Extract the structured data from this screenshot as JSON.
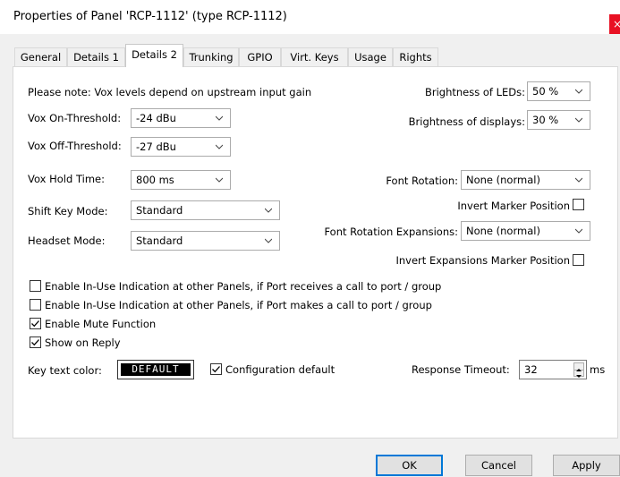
{
  "window": {
    "title": "Properties of Panel 'RCP-1112' (type RCP-1112)",
    "close_glyph": "×"
  },
  "tabs": [
    {
      "label": "General",
      "active": false
    },
    {
      "label": "Details 1",
      "active": false
    },
    {
      "label": "Details 2",
      "active": true
    },
    {
      "label": "Trunking",
      "active": false
    },
    {
      "label": "GPIO",
      "active": false
    },
    {
      "label": "Virt. Keys",
      "active": false
    },
    {
      "label": "Usage",
      "active": false
    },
    {
      "label": "Rights",
      "active": false
    }
  ],
  "details2": {
    "note": "Please note: Vox levels depend on upstream input gain",
    "vox_on": {
      "label": "Vox On-Threshold:",
      "value": "-24 dBu"
    },
    "vox_off": {
      "label": "Vox Off-Threshold:",
      "value": "-27 dBu"
    },
    "vox_hold": {
      "label": "Vox Hold Time:",
      "value": "800 ms"
    },
    "shift_key": {
      "label": "Shift Key Mode:",
      "value": "Standard"
    },
    "headset": {
      "label": "Headset Mode:",
      "value": "Standard"
    },
    "brightness_leds": {
      "label": "Brightness of LEDs:",
      "value": "50 %"
    },
    "brightness_displays": {
      "label": "Brightness of displays:",
      "value": "30 %"
    },
    "font_rotation": {
      "label": "Font Rotation:",
      "value": "None (normal)"
    },
    "invert_marker": {
      "label": "Invert Marker Position",
      "checked": false
    },
    "font_rotation_exp": {
      "label": "Font Rotation Expansions:",
      "value": "None (normal)"
    },
    "invert_exp_marker": {
      "label": "Invert Expansions Marker Position",
      "checked": false
    },
    "checkboxes": [
      {
        "label": "Enable In-Use Indication at other Panels, if Port receives a call to port / group",
        "checked": false
      },
      {
        "label": "Enable In-Use Indication at other Panels, if Port makes a call to port / group",
        "checked": false
      },
      {
        "label": "Enable Mute Function",
        "checked": true
      },
      {
        "label": "Show on Reply",
        "checked": true
      }
    ],
    "key_text_color": {
      "label": "Key text color:",
      "button": "DEFAULT"
    },
    "config_default": {
      "label": "Configuration default",
      "checked": true
    },
    "response_timeout": {
      "label": "Response Timeout:",
      "value": "32",
      "unit": "ms"
    }
  },
  "buttons": {
    "ok": "OK",
    "cancel": "Cancel",
    "apply": "Apply"
  },
  "colors": {
    "accent": "#0078d7",
    "close": "#e81123",
    "key_text_bg": "#000000",
    "key_text_fg": "#ffffff"
  }
}
